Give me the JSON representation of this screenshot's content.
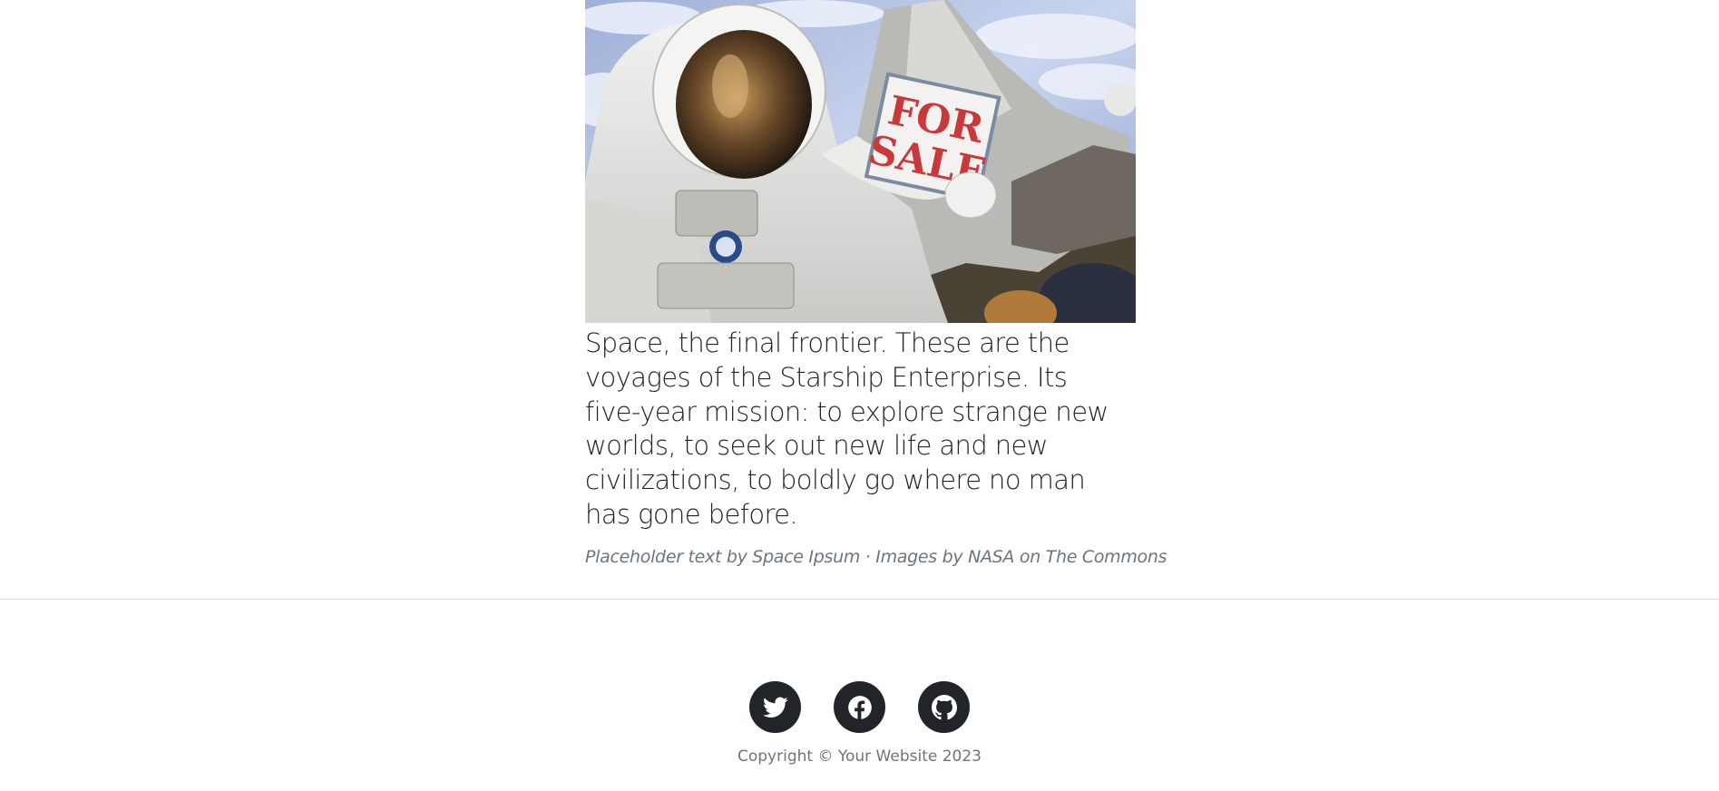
{
  "article": {
    "image_alt": "Astronaut in space holding a FOR SALE sign",
    "image_sign_text_line1": "FOR",
    "image_sign_text_line2": "SALE",
    "body": "Space, the final frontier. These are the voyages of the Starship Enterprise. Its five-year mission: to explore strange new worlds, to seek out new life and new civilizations, to boldly go where no man has gone before.",
    "caption": {
      "prefix": "Placeholder text by ",
      "link1": "Space Ipsum",
      "separator": " · Images by ",
      "link2": "NASA on The Commons"
    }
  },
  "footer": {
    "social": [
      {
        "icon": "twitter-icon"
      },
      {
        "icon": "facebook-icon"
      },
      {
        "icon": "github-icon"
      }
    ],
    "copyright": "Copyright © Your Website 2023",
    "colors": {
      "icon_bg": "#212529",
      "muted": "#6c757d"
    }
  }
}
